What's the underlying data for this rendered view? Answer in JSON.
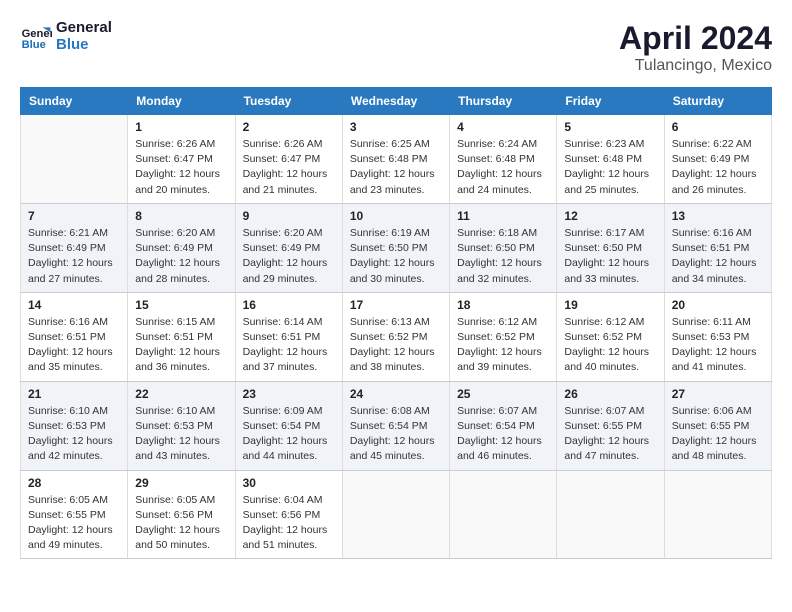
{
  "header": {
    "logo_line1": "General",
    "logo_line2": "Blue",
    "month": "April 2024",
    "location": "Tulancingo, Mexico"
  },
  "columns": [
    "Sunday",
    "Monday",
    "Tuesday",
    "Wednesday",
    "Thursday",
    "Friday",
    "Saturday"
  ],
  "rows": [
    [
      {
        "day": "",
        "info": ""
      },
      {
        "day": "1",
        "info": "Sunrise: 6:26 AM\nSunset: 6:47 PM\nDaylight: 12 hours\nand 20 minutes."
      },
      {
        "day": "2",
        "info": "Sunrise: 6:26 AM\nSunset: 6:47 PM\nDaylight: 12 hours\nand 21 minutes."
      },
      {
        "day": "3",
        "info": "Sunrise: 6:25 AM\nSunset: 6:48 PM\nDaylight: 12 hours\nand 23 minutes."
      },
      {
        "day": "4",
        "info": "Sunrise: 6:24 AM\nSunset: 6:48 PM\nDaylight: 12 hours\nand 24 minutes."
      },
      {
        "day": "5",
        "info": "Sunrise: 6:23 AM\nSunset: 6:48 PM\nDaylight: 12 hours\nand 25 minutes."
      },
      {
        "day": "6",
        "info": "Sunrise: 6:22 AM\nSunset: 6:49 PM\nDaylight: 12 hours\nand 26 minutes."
      }
    ],
    [
      {
        "day": "7",
        "info": "Sunrise: 6:21 AM\nSunset: 6:49 PM\nDaylight: 12 hours\nand 27 minutes."
      },
      {
        "day": "8",
        "info": "Sunrise: 6:20 AM\nSunset: 6:49 PM\nDaylight: 12 hours\nand 28 minutes."
      },
      {
        "day": "9",
        "info": "Sunrise: 6:20 AM\nSunset: 6:49 PM\nDaylight: 12 hours\nand 29 minutes."
      },
      {
        "day": "10",
        "info": "Sunrise: 6:19 AM\nSunset: 6:50 PM\nDaylight: 12 hours\nand 30 minutes."
      },
      {
        "day": "11",
        "info": "Sunrise: 6:18 AM\nSunset: 6:50 PM\nDaylight: 12 hours\nand 32 minutes."
      },
      {
        "day": "12",
        "info": "Sunrise: 6:17 AM\nSunset: 6:50 PM\nDaylight: 12 hours\nand 33 minutes."
      },
      {
        "day": "13",
        "info": "Sunrise: 6:16 AM\nSunset: 6:51 PM\nDaylight: 12 hours\nand 34 minutes."
      }
    ],
    [
      {
        "day": "14",
        "info": "Sunrise: 6:16 AM\nSunset: 6:51 PM\nDaylight: 12 hours\nand 35 minutes."
      },
      {
        "day": "15",
        "info": "Sunrise: 6:15 AM\nSunset: 6:51 PM\nDaylight: 12 hours\nand 36 minutes."
      },
      {
        "day": "16",
        "info": "Sunrise: 6:14 AM\nSunset: 6:51 PM\nDaylight: 12 hours\nand 37 minutes."
      },
      {
        "day": "17",
        "info": "Sunrise: 6:13 AM\nSunset: 6:52 PM\nDaylight: 12 hours\nand 38 minutes."
      },
      {
        "day": "18",
        "info": "Sunrise: 6:12 AM\nSunset: 6:52 PM\nDaylight: 12 hours\nand 39 minutes."
      },
      {
        "day": "19",
        "info": "Sunrise: 6:12 AM\nSunset: 6:52 PM\nDaylight: 12 hours\nand 40 minutes."
      },
      {
        "day": "20",
        "info": "Sunrise: 6:11 AM\nSunset: 6:53 PM\nDaylight: 12 hours\nand 41 minutes."
      }
    ],
    [
      {
        "day": "21",
        "info": "Sunrise: 6:10 AM\nSunset: 6:53 PM\nDaylight: 12 hours\nand 42 minutes."
      },
      {
        "day": "22",
        "info": "Sunrise: 6:10 AM\nSunset: 6:53 PM\nDaylight: 12 hours\nand 43 minutes."
      },
      {
        "day": "23",
        "info": "Sunrise: 6:09 AM\nSunset: 6:54 PM\nDaylight: 12 hours\nand 44 minutes."
      },
      {
        "day": "24",
        "info": "Sunrise: 6:08 AM\nSunset: 6:54 PM\nDaylight: 12 hours\nand 45 minutes."
      },
      {
        "day": "25",
        "info": "Sunrise: 6:07 AM\nSunset: 6:54 PM\nDaylight: 12 hours\nand 46 minutes."
      },
      {
        "day": "26",
        "info": "Sunrise: 6:07 AM\nSunset: 6:55 PM\nDaylight: 12 hours\nand 47 minutes."
      },
      {
        "day": "27",
        "info": "Sunrise: 6:06 AM\nSunset: 6:55 PM\nDaylight: 12 hours\nand 48 minutes."
      }
    ],
    [
      {
        "day": "28",
        "info": "Sunrise: 6:05 AM\nSunset: 6:55 PM\nDaylight: 12 hours\nand 49 minutes."
      },
      {
        "day": "29",
        "info": "Sunrise: 6:05 AM\nSunset: 6:56 PM\nDaylight: 12 hours\nand 50 minutes."
      },
      {
        "day": "30",
        "info": "Sunrise: 6:04 AM\nSunset: 6:56 PM\nDaylight: 12 hours\nand 51 minutes."
      },
      {
        "day": "",
        "info": ""
      },
      {
        "day": "",
        "info": ""
      },
      {
        "day": "",
        "info": ""
      },
      {
        "day": "",
        "info": ""
      }
    ]
  ]
}
